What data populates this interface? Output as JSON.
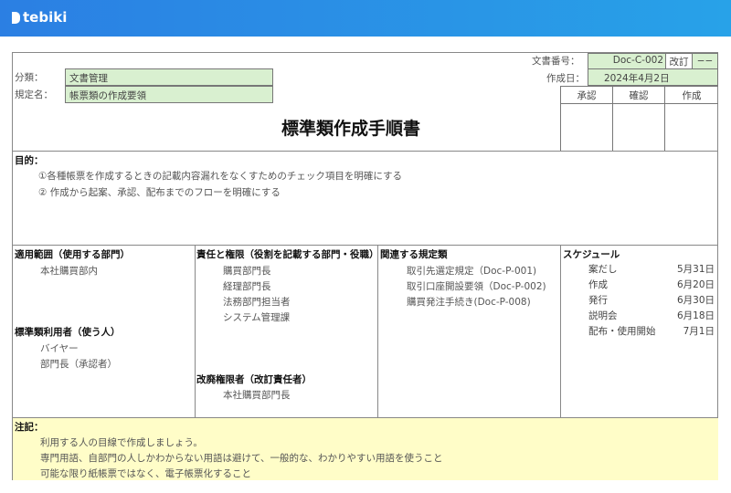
{
  "app": {
    "brand": "tebiki"
  },
  "header": {
    "category_label": "分類：",
    "category_value": "文書管理",
    "rule_label": "規定名：",
    "rule_value": "帳票類の作成要領",
    "doc_no_label": "文書番号：",
    "doc_no_value": "Doc-C-002",
    "revision_label": "改訂",
    "revision_value": "−−",
    "created_label": "作成日：",
    "created_value": "2024年4月2日",
    "title": "標準類作成手順書",
    "approvals": [
      "承認",
      "確認",
      "作成"
    ]
  },
  "purpose": {
    "heading": "目的：",
    "items": [
      "①各種帳票を作成するときの記載内容漏れをなくすためのチェック項目を明確にする",
      "② 作成から起案、承認、配布までのフローを明確にする"
    ]
  },
  "scope": {
    "heading": "適用範囲（使用する部門）",
    "items": [
      "本社購買部内"
    ]
  },
  "users": {
    "heading": "標準類利用者（使う人）",
    "items": [
      "バイヤー",
      "部門長（承認者）"
    ]
  },
  "responsibility": {
    "heading": "責任と権限（役割を記載する部門・役職）",
    "items": [
      "購買部門長",
      "経理部門長",
      "法務部門担当者",
      "システム管理課"
    ]
  },
  "revision_authority": {
    "heading": "改廃権限者（改訂責任者）",
    "items": [
      "本社購買部門長"
    ]
  },
  "related": {
    "heading": "関連する規定類",
    "items": [
      "取引先選定規定（Doc-P-001)",
      "取引口座開設要領（Doc-P-002)",
      "購買発注手続き(Doc-P-008)"
    ]
  },
  "schedule": {
    "heading": "スケジュール",
    "items": [
      {
        "task": "案だし",
        "date": "5月31日"
      },
      {
        "task": "作成",
        "date": "6月20日"
      },
      {
        "task": "発行",
        "date": "6月30日"
      },
      {
        "task": "説明会",
        "date": "6月18日"
      },
      {
        "task": "配布・使用開始",
        "date": "7月1日"
      }
    ]
  },
  "notes": {
    "heading": "注記：",
    "items": [
      "利用する人の目線で作成しましょう。",
      "専門用語、自部門の人しかわからない用語は避けて、一般的な、わかりやすい用語を使うこと",
      "可能な限り紙帳票ではなく、電子帳票化すること"
    ]
  }
}
